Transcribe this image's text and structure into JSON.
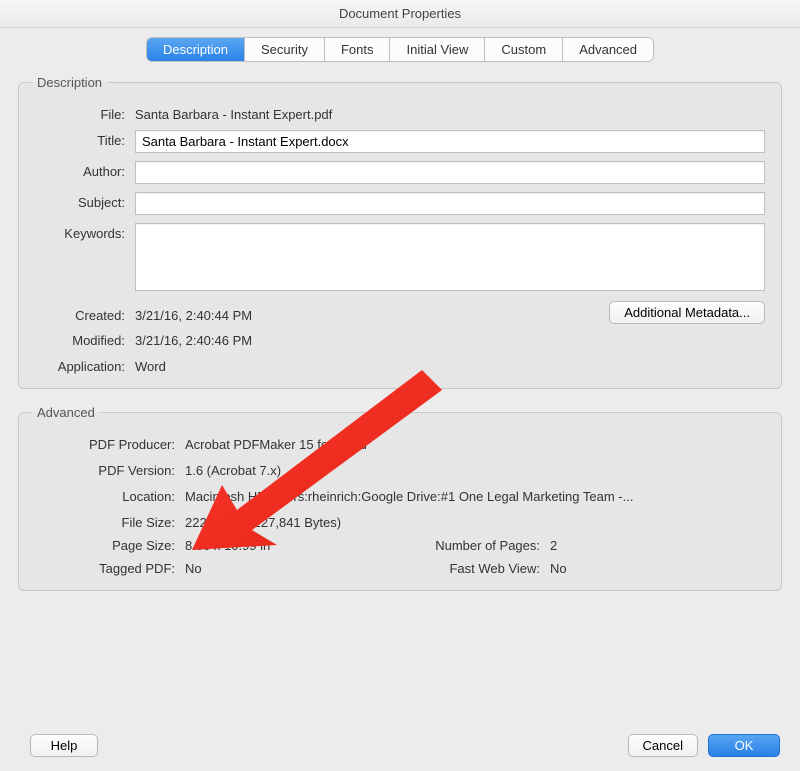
{
  "window": {
    "title": "Document Properties"
  },
  "tabs": [
    {
      "label": "Description",
      "active": true
    },
    {
      "label": "Security"
    },
    {
      "label": "Fonts"
    },
    {
      "label": "Initial View"
    },
    {
      "label": "Custom"
    },
    {
      "label": "Advanced"
    }
  ],
  "groups": {
    "description": {
      "legend": "Description",
      "file_label": "File:",
      "file_value": "Santa Barbara - Instant Expert.pdf",
      "title_label": "Title:",
      "title_value": "Santa Barbara - Instant Expert.docx",
      "author_label": "Author:",
      "author_value": "",
      "subject_label": "Subject:",
      "subject_value": "",
      "keywords_label": "Keywords:",
      "keywords_value": "",
      "created_label": "Created:",
      "created_value": "3/21/16, 2:40:44 PM",
      "modified_label": "Modified:",
      "modified_value": "3/21/16, 2:40:46 PM",
      "application_label": "Application:",
      "application_value": "Word",
      "additional_metadata_button": "Additional Metadata..."
    },
    "advanced": {
      "legend": "Advanced",
      "pdf_producer_label": "PDF Producer:",
      "pdf_producer_value": "Acrobat PDFMaker 15 for Word",
      "pdf_version_label": "PDF Version:",
      "pdf_version_value": "1.6 (Acrobat 7.x)",
      "location_label": "Location:",
      "location_value": "Macintosh HD:Users:rheinrich:Google Drive:#1 One Legal Marketing Team -...",
      "file_size_label": "File Size:",
      "file_size_value": "222.50 KB (227,841 Bytes)",
      "page_size_label": "Page Size:",
      "page_size_value": "8.50 x 10.99 in",
      "num_pages_label": "Number of Pages:",
      "num_pages_value": "2",
      "tagged_pdf_label": "Tagged PDF:",
      "tagged_pdf_value": "No",
      "fast_web_view_label": "Fast Web View:",
      "fast_web_view_value": "No"
    }
  },
  "buttons": {
    "help": "Help",
    "cancel": "Cancel",
    "ok": "OK"
  }
}
